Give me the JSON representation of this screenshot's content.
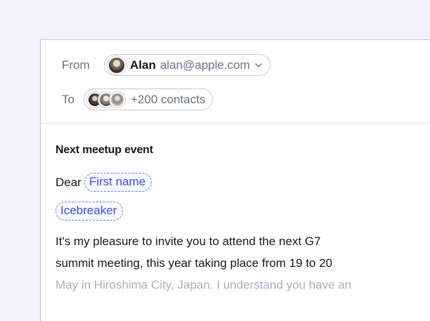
{
  "composer": {
    "from_label": "From",
    "sender_name": "Alan",
    "sender_email": "alan@apple.com",
    "to_label": "To",
    "recipients_count": "+200 contacts",
    "subject": "Next meetup event",
    "greeting": "Dear",
    "variable_first_name": "First name",
    "variable_icebreaker": "Icebreaker",
    "body_line_1": "It's my pleasure to invite you to attend the next G7",
    "body_line_2": "summit meeting, this year taking place from 19 to 20",
    "body_line_3": "May in Hiroshima City, Japan. I understand you have an"
  },
  "icons": [
    "sender-avatar",
    "chevron-down-icon",
    "recipient-avatar"
  ],
  "colors": {
    "accent": "#3b50d6",
    "background": "#f3f4fd",
    "border": "#b7c2f3"
  }
}
